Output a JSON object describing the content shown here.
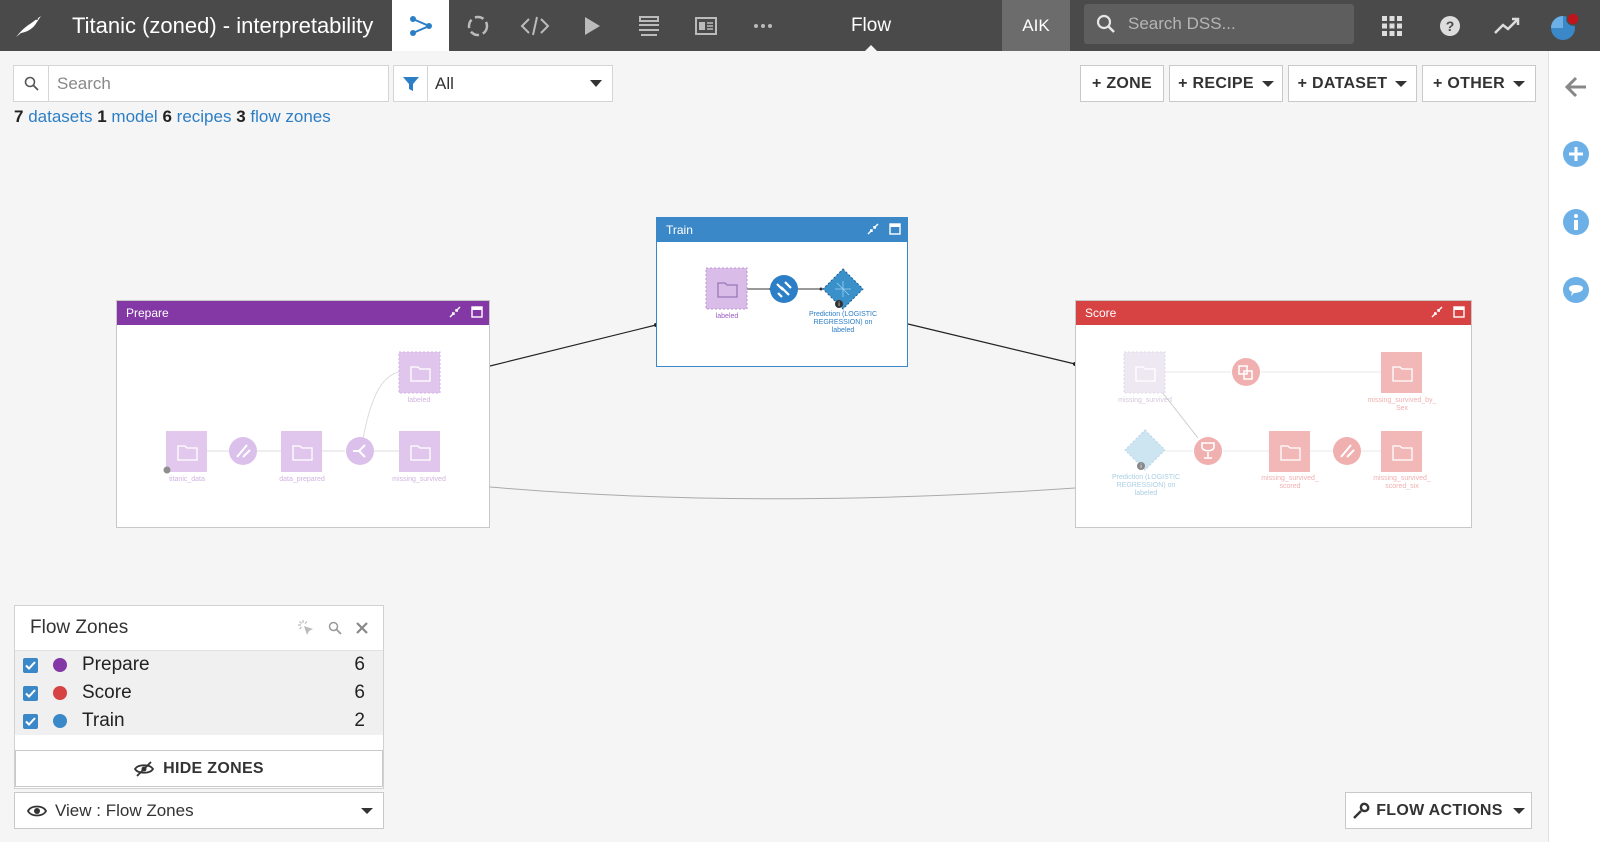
{
  "header": {
    "project_title": "Titanic (zoned) - interpretability",
    "current_view": "Flow",
    "user_initials": "AIK",
    "search_placeholder": "Search DSS..."
  },
  "toolbar": {
    "search_placeholder": "Search",
    "filter_value": "All",
    "buttons": {
      "zone": "+ ZONE",
      "recipe": "+ RECIPE",
      "dataset": "+ DATASET",
      "other": "+ OTHER"
    }
  },
  "counts": {
    "datasets_n": "7",
    "datasets_label": "datasets",
    "models_n": "1",
    "models_label": "model",
    "recipes_n": "6",
    "recipes_label": "recipes",
    "zones_n": "3",
    "zones_label": "flow zones"
  },
  "zones": {
    "train": {
      "title": "Train",
      "color": "#3b88c9",
      "nodes": {
        "dataset": "labeled",
        "model_l1": "Prediction (LOGISTIC",
        "model_l2": "REGRESSION) on",
        "model_l3": "labeled"
      }
    },
    "prepare": {
      "title": "Prepare",
      "color": "#8338a6",
      "nodes": {
        "titanic": "titanic_data",
        "prepared": "data_prepared",
        "labeled": "labeled",
        "missing": "missing_survived"
      }
    },
    "score": {
      "title": "Score",
      "color": "#d74343",
      "nodes": {
        "missing": "missing_survived",
        "by_sex_l1": "missing_survived_by_",
        "by_sex_l2": "Sex",
        "model_l1": "Prediction (LOGISTIC",
        "model_l2": "REGRESSION) on",
        "model_l3": "labeled",
        "scored_l1": "missing_survived_",
        "scored_l2": "scored",
        "scored_six_l1": "missing_survived_",
        "scored_six_l2": "scored_six"
      }
    }
  },
  "flow_zones_panel": {
    "title": "Flow Zones",
    "rows": [
      {
        "name": "Prepare",
        "count": "6",
        "color": "#8338a6"
      },
      {
        "name": "Score",
        "count": "6",
        "color": "#d74343"
      },
      {
        "name": "Train",
        "count": "2",
        "color": "#3b88c9"
      }
    ],
    "hide_zones": "HIDE ZONES",
    "view_label": "View : Flow Zones"
  },
  "flow_actions": "FLOW ACTIONS"
}
